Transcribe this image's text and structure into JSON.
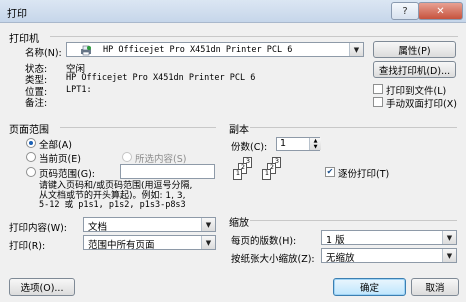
{
  "window": {
    "title": "打印",
    "help_label": "?",
    "close_label": "✕"
  },
  "printer": {
    "section_title": "打印机",
    "name_label": "名称(N):",
    "name_value": "HP Officejet Pro X451dn Printer PCL 6",
    "status_label": "状态:",
    "status_value": "空闲",
    "type_label": "类型:",
    "type_value": "HP Officejet Pro X451dn Printer PCL 6",
    "location_label": "位置:",
    "location_value": "LPT1:",
    "comment_label": "备注:",
    "properties_button": "属性(P)",
    "find_printer_button": "查找打印机(D)...",
    "print_to_file_label": "打印到文件(L)",
    "print_to_file_checked": false,
    "manual_duplex_label": "手动双面打印(X)",
    "manual_duplex_checked": false
  },
  "page_range": {
    "section_title": "页面范围",
    "all_label": "全部(A)",
    "current_label": "当前页(E)",
    "selection_label": "所选内容(S)",
    "pages_label": "页码范围(G):",
    "pages_value": "",
    "selected": "all",
    "help_line1": "请键入页码和/或页码范围(用逗号分隔,",
    "help_line2": "从文档或节的开头算起)。例如: 1, 3,",
    "help_line3": "5-12 或 p1s1, p1s2, p1s3-p8s3"
  },
  "copies": {
    "section_title": "副本",
    "count_label": "份数(C):",
    "count_value": "1",
    "collate_label": "逐份打印(T)",
    "collate_checked": true,
    "page_numbers": [
      "1",
      "2",
      "3"
    ]
  },
  "print_what": {
    "label": "打印内容(W):",
    "value": "文档"
  },
  "print": {
    "label": "打印(R):",
    "value": "范围中所有页面"
  },
  "zoom": {
    "section_title": "缩放",
    "pages_per_sheet_label": "每页的版数(H):",
    "pages_per_sheet_value": "1 版",
    "scale_label": "按纸张大小缩放(Z):",
    "scale_value": "无缩放"
  },
  "footer": {
    "options_button": "选项(O)...",
    "ok_button": "确定",
    "cancel_button": "取消"
  }
}
